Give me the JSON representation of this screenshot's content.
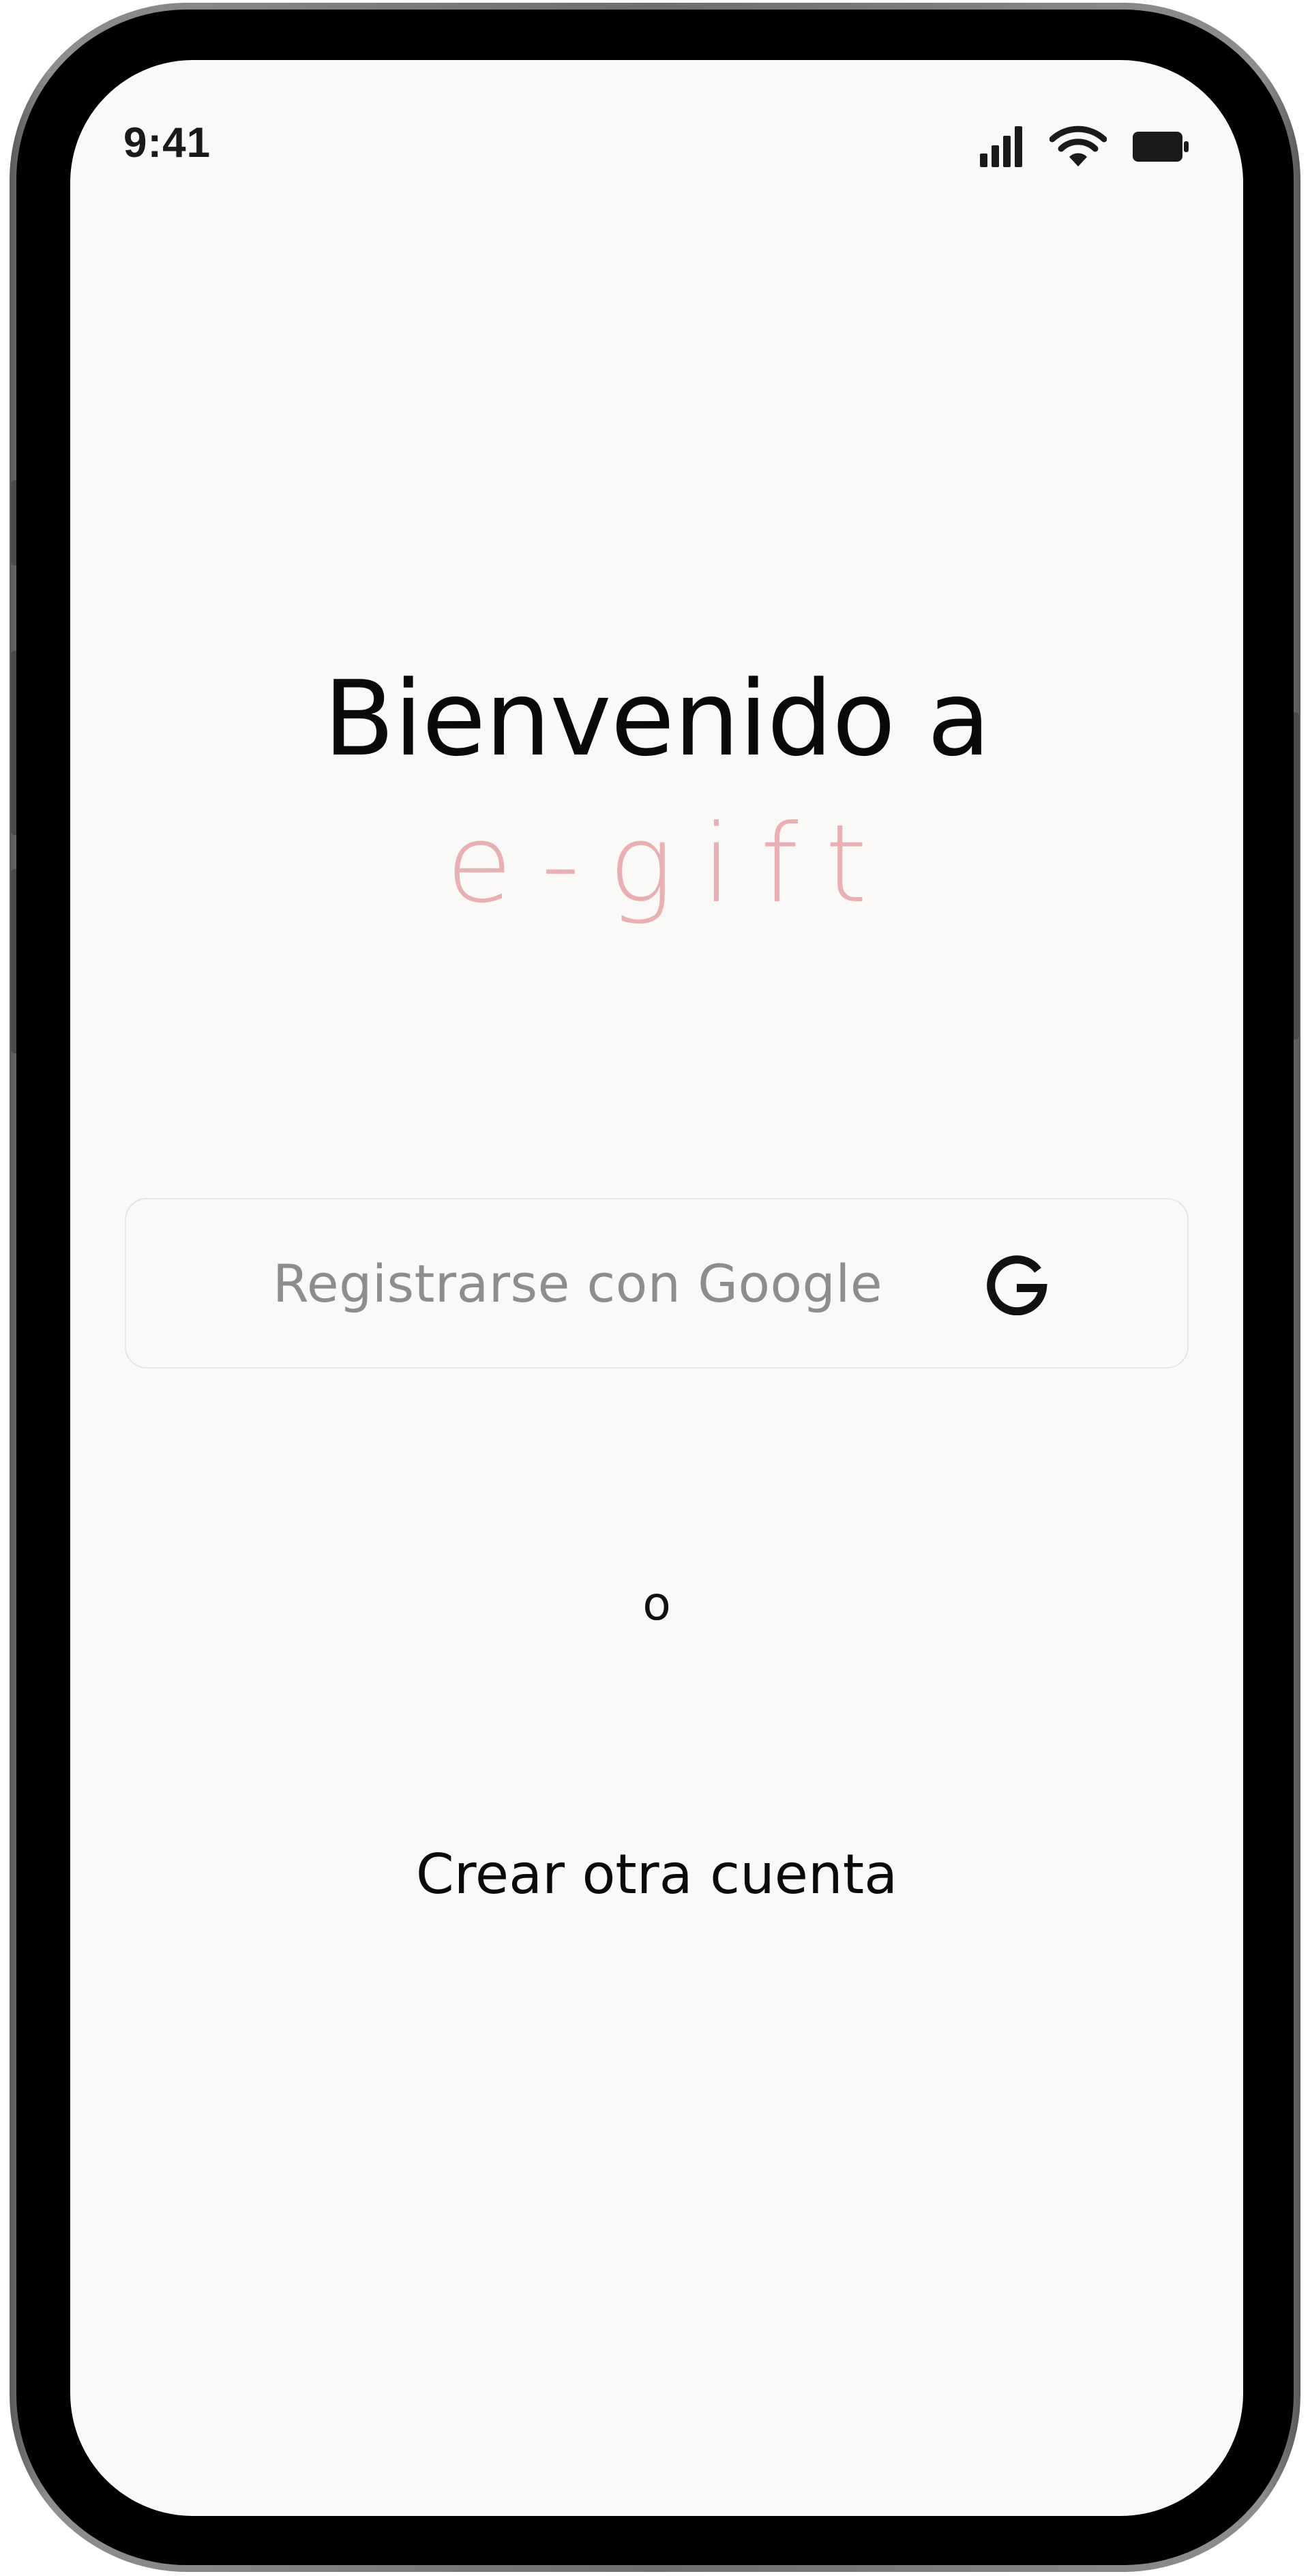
{
  "status_bar": {
    "time": "9:41",
    "icons": [
      "cellular-signal-icon",
      "wifi-icon",
      "battery-icon"
    ]
  },
  "welcome": {
    "title": "Bienvenido a",
    "brand": "e-gift"
  },
  "google_signup": {
    "label": "Registrarse con Google",
    "icon": "google-g-icon"
  },
  "divider": {
    "text": "o"
  },
  "create_account": {
    "label": "Crear otra cuenta"
  },
  "colors": {
    "background": "#faf9f7",
    "brand": "#e9b0b3",
    "text": "#0a0a0a",
    "muted_text": "#8d8d8d"
  }
}
